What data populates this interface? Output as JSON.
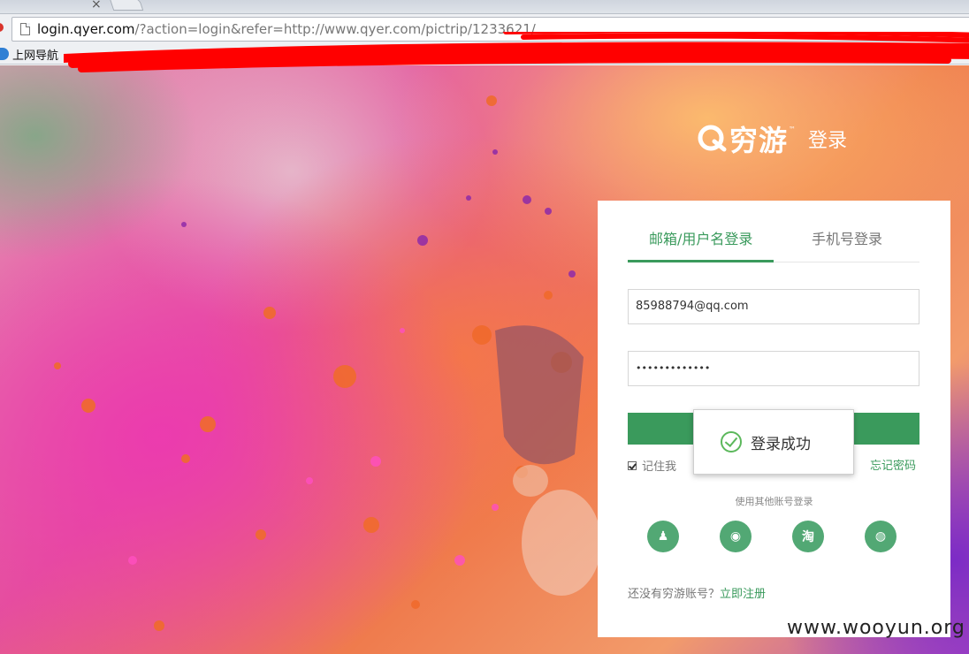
{
  "browser": {
    "tab_close_glyph": "×",
    "url_host": "login.qyer.com",
    "url_rest": "/?action=login&refer=http://www.qyer.com/pictrip/1233621/",
    "bookmark_label": "上网导航"
  },
  "brand": {
    "name": "穷游",
    "tm": "™",
    "page_title": "登录"
  },
  "login": {
    "tabs": [
      {
        "label": "邮箱/用户名登录",
        "active": true
      },
      {
        "label": "手机号登录",
        "active": false
      }
    ],
    "username_value": "85988794@qq.com",
    "password_mask": "•••••••••••••",
    "remember_label": "记住我",
    "remember_checked": true,
    "forgot_label": "忘记密码",
    "other_login_title": "使用其他账号登录",
    "social": [
      {
        "name": "qq-icon",
        "glyph": "♟"
      },
      {
        "name": "weibo-icon",
        "glyph": "◉"
      },
      {
        "name": "taobao-icon",
        "glyph": "淘"
      },
      {
        "name": "wechat-icon",
        "glyph": "◍"
      }
    ],
    "signup_prompt": "还没有穷游账号？",
    "signup_link": "立即注册"
  },
  "toast": {
    "message": "登录成功"
  },
  "watermark": "www.wooyun.org",
  "colors": {
    "accent_green": "#3a9a5c",
    "toast_check": "#5cb85c",
    "redaction": "#ff0000"
  }
}
